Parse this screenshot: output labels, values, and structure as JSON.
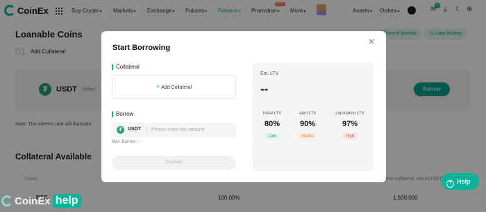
{
  "nav": {
    "logo": "CoinEx",
    "items": [
      {
        "label": "Buy Crypto"
      },
      {
        "label": "Markets"
      },
      {
        "label": "Exchange"
      },
      {
        "label": "Futures"
      },
      {
        "label": "Finance",
        "active": true
      },
      {
        "label": "Promotion",
        "badge": "HOT"
      },
      {
        "label": "More"
      }
    ],
    "right": {
      "assets": "Assets",
      "orders": "Orders",
      "notification_count": "4"
    },
    "accent_color": "#00b49a"
  },
  "page": {
    "title": "Loanable Coins",
    "step_number": "01",
    "step_label": "Add Collateral",
    "current_borrow_label": "Current Borrow",
    "loan_history_label": "Loan History",
    "coin": {
      "symbol": "USDT",
      "name": "Tether"
    },
    "borrow_button": "Borrow",
    "note": "Note: The interest rate will fluctuate",
    "collateral_section": {
      "title": "Collateral Available",
      "columns": [
        "Coins",
        "Effective collateral value(USDT)"
      ],
      "rows": [
        {
          "coin": "BTC",
          "ratio": "100.00%",
          "value": "1,500,000"
        }
      ]
    }
  },
  "modal": {
    "title": "Start Borrowing",
    "collateral_label": "Collateral",
    "add_collateral_label": "Add Collateral",
    "borrow_label": "Borrow",
    "currency": "USDT",
    "amount_placeholder": "Please enter the amount",
    "amount_value": "",
    "max_borrow": "Max. Borrow: --",
    "confirm_label": "Confirm",
    "ltv": {
      "label": "Est. LTV",
      "value": "--",
      "levels": [
        {
          "title": "Initial LTV",
          "value": "80%",
          "tag": "Low",
          "tag_color": "#00a38b"
        },
        {
          "title": "Alert LTV",
          "value": "90%",
          "tag": "Middle",
          "tag_color": "#e8813f"
        },
        {
          "title": "Liquidation LTV",
          "value": "97%",
          "tag": "High",
          "tag_color": "#e34c4c"
        }
      ]
    }
  },
  "help_button": "Help",
  "watermark": {
    "brand": "CoinEx",
    "suffix": "help"
  }
}
